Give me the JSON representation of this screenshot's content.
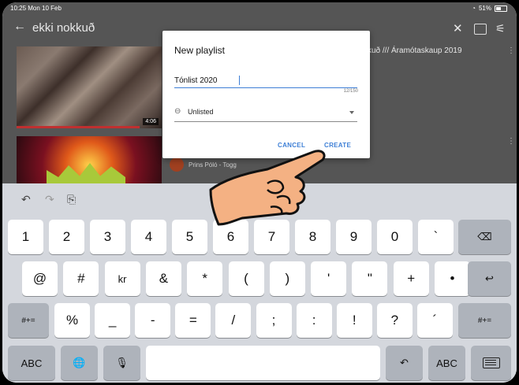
{
  "status": {
    "time": "10:25  Mon 10 Feb",
    "battery": "51%"
  },
  "app": {
    "back_icon": "←",
    "title": "ekki nokkuð",
    "close_icon": "✕",
    "filter_icon": "⚟",
    "video1": {
      "title_fragment": "kkuð /// Áramótaskaup 2019",
      "duration": "4:06",
      "watched_fraction": 0.85
    },
    "video2": {
      "channel_fragment": "Prins Póló - Togg"
    },
    "more_icon": "⋮"
  },
  "dialog": {
    "title": "New playlist",
    "name_value": "Tónlist 2020",
    "counter": "12/150",
    "privacy": "Unlisted",
    "cancel_label": "CANCEL",
    "create_label": "CREATE"
  },
  "keyboard": {
    "shortcuts": {
      "undo": "↶",
      "redo": "↷",
      "paste": "⎘"
    },
    "row1": [
      "1",
      "2",
      "3",
      "4",
      "5",
      "6",
      "7",
      "8",
      "9",
      "0",
      "`"
    ],
    "delete_icon": "⌫",
    "row2": [
      "@",
      "#",
      "kr",
      "&",
      "*",
      "(",
      ")",
      "'",
      "\"",
      "+",
      "•"
    ],
    "return_icon": "↩",
    "row3_left": "#+=",
    "row3": [
      "%",
      "_",
      "-",
      "=",
      "/",
      ";",
      ":",
      "!",
      "?",
      "´"
    ],
    "row3_right": "#+=",
    "abc_left": "ABC",
    "globe_icon": "🌐",
    "mic_icon": "🎙",
    "undo_key_icon": "↶",
    "abc_right": "ABC"
  }
}
